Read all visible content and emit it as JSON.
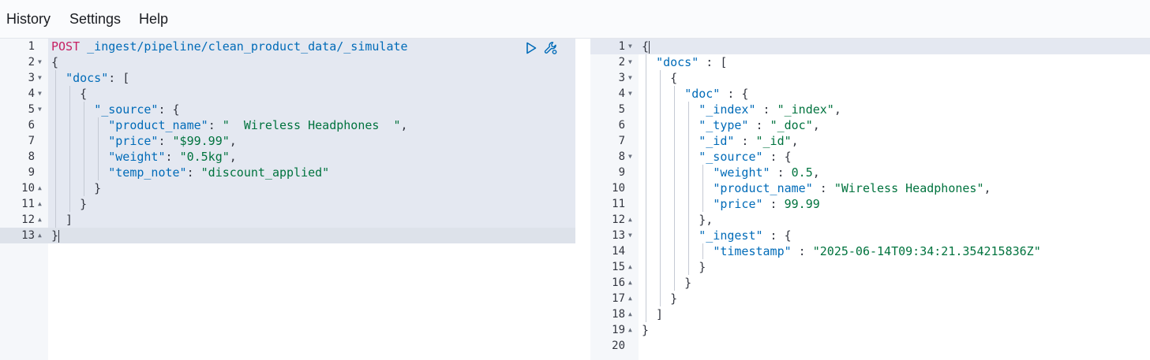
{
  "menu": {
    "history": "History",
    "settings": "Settings",
    "help": "Help"
  },
  "icons": {
    "run": "play-icon",
    "settings": "wrench-icon"
  },
  "colors": {
    "method": "#c61e62",
    "key": "#006bb8",
    "string": "#00733e",
    "punct": "#343741"
  },
  "request": {
    "lines": [
      {
        "n": "1",
        "fold": "",
        "indent": 0,
        "tokens": [
          {
            "t": "POST",
            "c": "k-method"
          },
          {
            "t": " _ingest/pipeline/clean_product_data/_simulate",
            "c": "k-url"
          }
        ]
      },
      {
        "n": "2",
        "fold": "down",
        "indent": 0,
        "tokens": [
          {
            "t": "{",
            "c": "k-p"
          }
        ]
      },
      {
        "n": "3",
        "fold": "down",
        "indent": 1,
        "tokens": [
          {
            "t": "  ",
            "c": "k-p"
          },
          {
            "t": "\"docs\"",
            "c": "k-key"
          },
          {
            "t": ": [",
            "c": "k-p"
          }
        ]
      },
      {
        "n": "4",
        "fold": "down",
        "indent": 2,
        "tokens": [
          {
            "t": "    {",
            "c": "k-p"
          }
        ]
      },
      {
        "n": "5",
        "fold": "down",
        "indent": 3,
        "tokens": [
          {
            "t": "      ",
            "c": "k-p"
          },
          {
            "t": "\"_source\"",
            "c": "k-key"
          },
          {
            "t": ": {",
            "c": "k-p"
          }
        ]
      },
      {
        "n": "6",
        "fold": "",
        "indent": 4,
        "tokens": [
          {
            "t": "        ",
            "c": "k-p"
          },
          {
            "t": "\"product_name\"",
            "c": "k-key"
          },
          {
            "t": ": ",
            "c": "k-p"
          },
          {
            "t": "\"  Wireless Headphones  \"",
            "c": "k-str"
          },
          {
            "t": ",",
            "c": "k-p"
          }
        ]
      },
      {
        "n": "7",
        "fold": "",
        "indent": 4,
        "tokens": [
          {
            "t": "        ",
            "c": "k-p"
          },
          {
            "t": "\"price\"",
            "c": "k-key"
          },
          {
            "t": ": ",
            "c": "k-p"
          },
          {
            "t": "\"$99.99\"",
            "c": "k-str"
          },
          {
            "t": ",",
            "c": "k-p"
          }
        ]
      },
      {
        "n": "8",
        "fold": "",
        "indent": 4,
        "tokens": [
          {
            "t": "        ",
            "c": "k-p"
          },
          {
            "t": "\"weight\"",
            "c": "k-key"
          },
          {
            "t": ": ",
            "c": "k-p"
          },
          {
            "t": "\"0.5kg\"",
            "c": "k-str"
          },
          {
            "t": ",",
            "c": "k-p"
          }
        ]
      },
      {
        "n": "9",
        "fold": "",
        "indent": 4,
        "tokens": [
          {
            "t": "        ",
            "c": "k-p"
          },
          {
            "t": "\"temp_note\"",
            "c": "k-key"
          },
          {
            "t": ": ",
            "c": "k-p"
          },
          {
            "t": "\"discount_applied\"",
            "c": "k-str"
          }
        ]
      },
      {
        "n": "10",
        "fold": "up",
        "indent": 3,
        "tokens": [
          {
            "t": "      }",
            "c": "k-p"
          }
        ]
      },
      {
        "n": "11",
        "fold": "up",
        "indent": 2,
        "tokens": [
          {
            "t": "    }",
            "c": "k-p"
          }
        ]
      },
      {
        "n": "12",
        "fold": "up",
        "indent": 1,
        "tokens": [
          {
            "t": "  ]",
            "c": "k-p"
          }
        ]
      },
      {
        "n": "13",
        "fold": "up",
        "indent": 0,
        "tokens": [
          {
            "t": "}",
            "c": "k-p"
          }
        ]
      }
    ]
  },
  "response": {
    "lines": [
      {
        "n": "1",
        "fold": "down",
        "indent": 0,
        "tokens": [
          {
            "t": "{",
            "c": "k-p"
          }
        ]
      },
      {
        "n": "2",
        "fold": "down",
        "indent": 1,
        "tokens": [
          {
            "t": "  ",
            "c": "k-p"
          },
          {
            "t": "\"docs\"",
            "c": "k-key"
          },
          {
            "t": " : [",
            "c": "k-p"
          }
        ]
      },
      {
        "n": "3",
        "fold": "down",
        "indent": 2,
        "tokens": [
          {
            "t": "    {",
            "c": "k-p"
          }
        ]
      },
      {
        "n": "4",
        "fold": "down",
        "indent": 3,
        "tokens": [
          {
            "t": "      ",
            "c": "k-p"
          },
          {
            "t": "\"doc\"",
            "c": "k-key"
          },
          {
            "t": " : {",
            "c": "k-p"
          }
        ]
      },
      {
        "n": "5",
        "fold": "",
        "indent": 4,
        "tokens": [
          {
            "t": "        ",
            "c": "k-p"
          },
          {
            "t": "\"_index\"",
            "c": "k-key"
          },
          {
            "t": " : ",
            "c": "k-p"
          },
          {
            "t": "\"_index\"",
            "c": "k-str"
          },
          {
            "t": ",",
            "c": "k-p"
          }
        ]
      },
      {
        "n": "6",
        "fold": "",
        "indent": 4,
        "tokens": [
          {
            "t": "        ",
            "c": "k-p"
          },
          {
            "t": "\"_type\"",
            "c": "k-key"
          },
          {
            "t": " : ",
            "c": "k-p"
          },
          {
            "t": "\"_doc\"",
            "c": "k-str"
          },
          {
            "t": ",",
            "c": "k-p"
          }
        ]
      },
      {
        "n": "7",
        "fold": "",
        "indent": 4,
        "tokens": [
          {
            "t": "        ",
            "c": "k-p"
          },
          {
            "t": "\"_id\"",
            "c": "k-key"
          },
          {
            "t": " : ",
            "c": "k-p"
          },
          {
            "t": "\"_id\"",
            "c": "k-str"
          },
          {
            "t": ",",
            "c": "k-p"
          }
        ]
      },
      {
        "n": "8",
        "fold": "down",
        "indent": 4,
        "tokens": [
          {
            "t": "        ",
            "c": "k-p"
          },
          {
            "t": "\"_source\"",
            "c": "k-key"
          },
          {
            "t": " : {",
            "c": "k-p"
          }
        ]
      },
      {
        "n": "9",
        "fold": "",
        "indent": 5,
        "tokens": [
          {
            "t": "          ",
            "c": "k-p"
          },
          {
            "t": "\"weight\"",
            "c": "k-key"
          },
          {
            "t": " : ",
            "c": "k-p"
          },
          {
            "t": "0.5",
            "c": "k-num"
          },
          {
            "t": ",",
            "c": "k-p"
          }
        ]
      },
      {
        "n": "10",
        "fold": "",
        "indent": 5,
        "tokens": [
          {
            "t": "          ",
            "c": "k-p"
          },
          {
            "t": "\"product_name\"",
            "c": "k-key"
          },
          {
            "t": " : ",
            "c": "k-p"
          },
          {
            "t": "\"Wireless Headphones\"",
            "c": "k-str"
          },
          {
            "t": ",",
            "c": "k-p"
          }
        ]
      },
      {
        "n": "11",
        "fold": "",
        "indent": 5,
        "tokens": [
          {
            "t": "          ",
            "c": "k-p"
          },
          {
            "t": "\"price\"",
            "c": "k-key"
          },
          {
            "t": " : ",
            "c": "k-p"
          },
          {
            "t": "99.99",
            "c": "k-num"
          }
        ]
      },
      {
        "n": "12",
        "fold": "up",
        "indent": 4,
        "tokens": [
          {
            "t": "        },",
            "c": "k-p"
          }
        ]
      },
      {
        "n": "13",
        "fold": "down",
        "indent": 4,
        "tokens": [
          {
            "t": "        ",
            "c": "k-p"
          },
          {
            "t": "\"_ingest\"",
            "c": "k-key"
          },
          {
            "t": " : {",
            "c": "k-p"
          }
        ]
      },
      {
        "n": "14",
        "fold": "",
        "indent": 5,
        "tokens": [
          {
            "t": "          ",
            "c": "k-p"
          },
          {
            "t": "\"timestamp\"",
            "c": "k-key"
          },
          {
            "t": " : ",
            "c": "k-p"
          },
          {
            "t": "\"2025-06-14T09:34:21.354215836Z\"",
            "c": "k-str"
          }
        ]
      },
      {
        "n": "15",
        "fold": "up",
        "indent": 4,
        "tokens": [
          {
            "t": "        }",
            "c": "k-p"
          }
        ]
      },
      {
        "n": "16",
        "fold": "up",
        "indent": 3,
        "tokens": [
          {
            "t": "      }",
            "c": "k-p"
          }
        ]
      },
      {
        "n": "17",
        "fold": "up",
        "indent": 2,
        "tokens": [
          {
            "t": "    }",
            "c": "k-p"
          }
        ]
      },
      {
        "n": "18",
        "fold": "up",
        "indent": 1,
        "tokens": [
          {
            "t": "  ]",
            "c": "k-p"
          }
        ]
      },
      {
        "n": "19",
        "fold": "up",
        "indent": 0,
        "tokens": [
          {
            "t": "}",
            "c": "k-p"
          }
        ]
      },
      {
        "n": "20",
        "fold": "",
        "indent": 0,
        "tokens": []
      }
    ]
  }
}
